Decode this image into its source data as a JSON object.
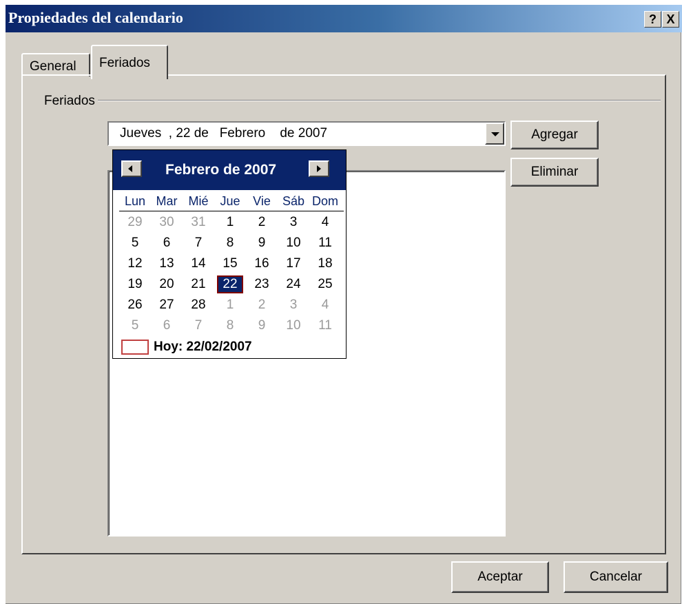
{
  "window": {
    "title": "Propiedades del calendario",
    "help_button": "?",
    "close_button": "X"
  },
  "tabs": [
    {
      "label": "General",
      "active": false
    },
    {
      "label": "Feriados",
      "active": true
    }
  ],
  "group": {
    "label": "Feriados"
  },
  "date_combo": {
    "value": "Jueves  , 22 de   Febrero    de 2007"
  },
  "buttons": {
    "add": "Agregar",
    "remove": "Eliminar",
    "ok": "Aceptar",
    "cancel": "Cancelar"
  },
  "calendar": {
    "title": "Febrero de 2007",
    "weekdays": [
      "Lun",
      "Mar",
      "Mié",
      "Jue",
      "Vie",
      "Sáb",
      "Dom"
    ],
    "days": [
      [
        "29",
        "30",
        "31",
        "1",
        "2",
        "3",
        "4"
      ],
      [
        "5",
        "6",
        "7",
        "8",
        "9",
        "10",
        "11"
      ],
      [
        "12",
        "13",
        "14",
        "15",
        "16",
        "17",
        "18"
      ],
      [
        "19",
        "20",
        "21",
        "22",
        "23",
        "24",
        "25"
      ],
      [
        "26",
        "27",
        "28",
        "1",
        "2",
        "3",
        "4"
      ],
      [
        "5",
        "6",
        "7",
        "8",
        "9",
        "10",
        "11"
      ]
    ],
    "selected_day": "22",
    "today_label": "Hoy: 22/02/2007"
  },
  "colors": {
    "titlebar_start": "#0a246a",
    "titlebar_end": "#a6caf0",
    "calendar_header": "#0a246a",
    "dialog_face": "#d4d0c8"
  }
}
